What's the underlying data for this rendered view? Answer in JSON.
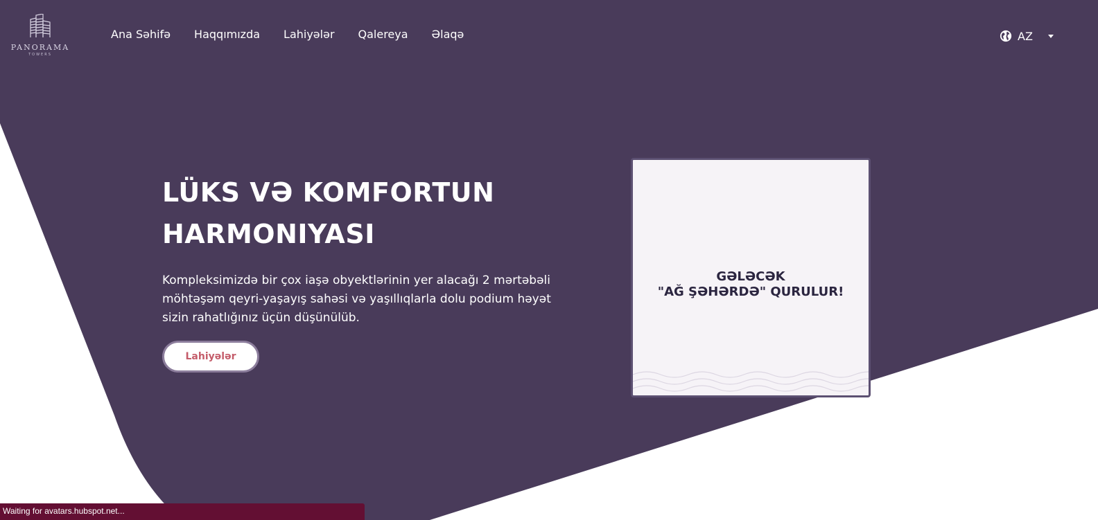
{
  "brand": {
    "name": "PANORAMA",
    "tagline": "TOWERS"
  },
  "nav": {
    "items": [
      "Ana Səhifə",
      "Haqqımızda",
      "Lahiyələr",
      "Qalereya",
      "Əlaqə"
    ]
  },
  "language": {
    "current": "AZ",
    "icon": "globe-icon"
  },
  "hero": {
    "title_line1": "LÜKS VƏ KOMFORTUN",
    "title_line2": "HARMONIYASI",
    "description": "Kompleksimizdə bir çox iaşə obyektlərinin yer alacağı 2 mərtəbəli möhtəşəm qeyri-yaşayış sahəsi və yaşıllıqlarla dolu podium həyət sizin rahatlığınız üçün düşünülüb.",
    "button_label": "Lahiyələr"
  },
  "promo": {
    "line1": "GƏLƏCƏK",
    "line2": "\"AĞ ŞƏHƏRDƏ\" QURULUR!"
  },
  "status": {
    "text": "Waiting for avatars.hubspot.net..."
  },
  "colors": {
    "primary_bg": "#493b5a",
    "white": "#ffffff",
    "button_text": "#c45c6a",
    "status_bar": "#630f33"
  }
}
